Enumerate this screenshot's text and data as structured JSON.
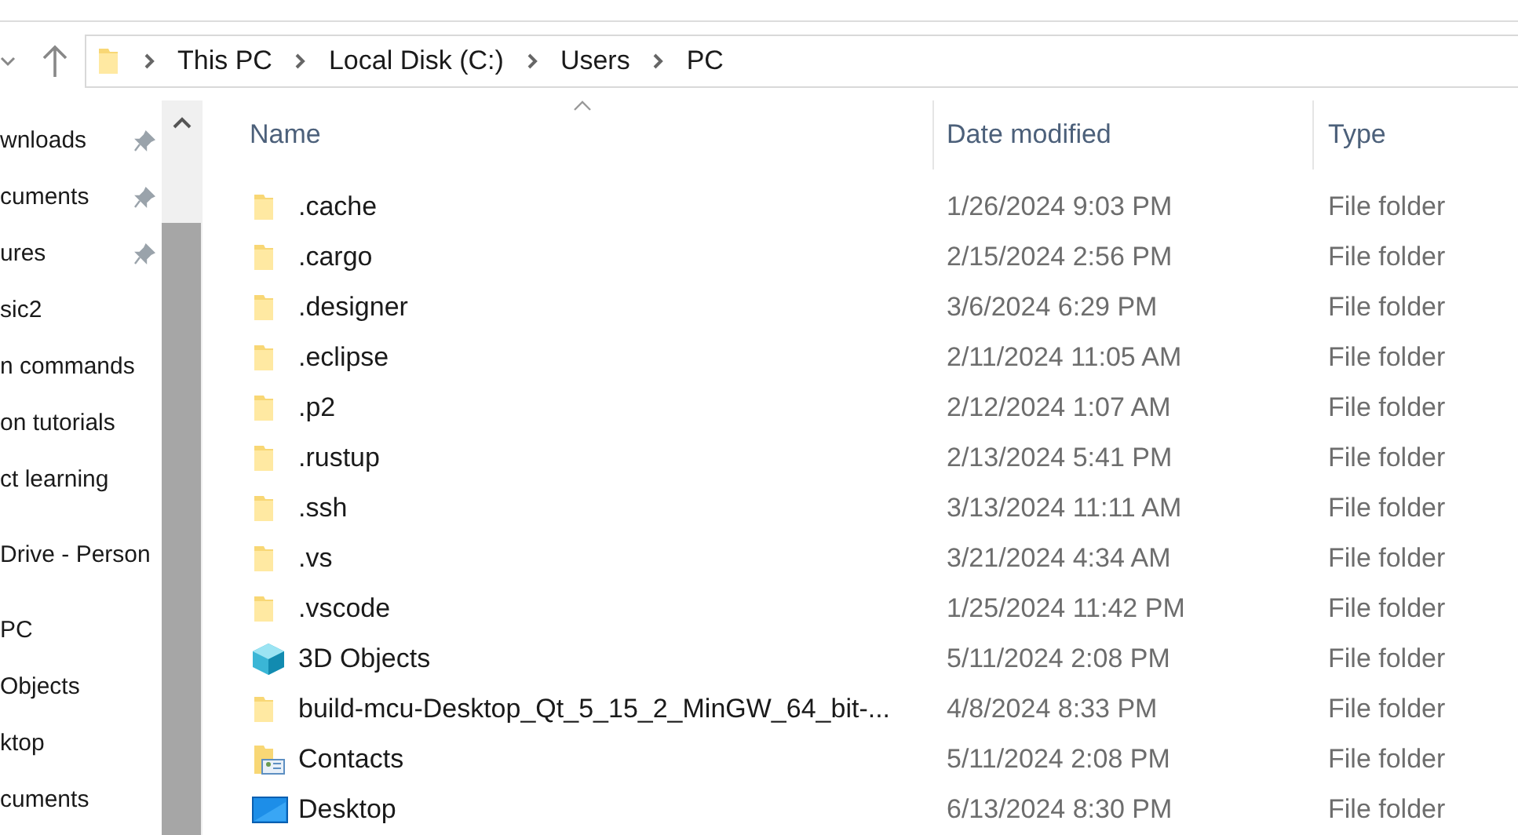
{
  "address_bar": {
    "crumbs": [
      "This PC",
      "Local Disk (C:)",
      "Users",
      "PC"
    ]
  },
  "sidebar": {
    "sections": [
      {
        "items": [
          {
            "label": "wnloads",
            "pinned": true
          },
          {
            "label": "cuments",
            "pinned": true
          },
          {
            "label": "ures",
            "pinned": true
          },
          {
            "label": "sic2",
            "pinned": false
          },
          {
            "label": "n commands",
            "pinned": false
          },
          {
            "label": "on tutorials",
            "pinned": false
          },
          {
            "label": "ct learning",
            "pinned": false
          }
        ]
      },
      {
        "items": [
          {
            "label": "Drive - Person",
            "pinned": false
          }
        ]
      },
      {
        "items": [
          {
            "label": "PC",
            "pinned": false
          },
          {
            "label": "Objects",
            "pinned": false
          },
          {
            "label": "ktop",
            "pinned": false
          },
          {
            "label": "cuments",
            "pinned": false
          }
        ]
      }
    ]
  },
  "table": {
    "columns": [
      {
        "label": "Name",
        "sorted": true
      },
      {
        "label": "Date modified",
        "sorted": false
      },
      {
        "label": "Type",
        "sorted": false
      }
    ],
    "rows": [
      {
        "kind": "folder",
        "name": ".cache",
        "date": "1/26/2024 9:03 PM",
        "type": "File folder"
      },
      {
        "kind": "folder",
        "name": ".cargo",
        "date": "2/15/2024 2:56 PM",
        "type": "File folder"
      },
      {
        "kind": "folder",
        "name": ".designer",
        "date": "3/6/2024 6:29 PM",
        "type": "File folder"
      },
      {
        "kind": "folder",
        "name": ".eclipse",
        "date": "2/11/2024 11:05 AM",
        "type": "File folder"
      },
      {
        "kind": "folder",
        "name": ".p2",
        "date": "2/12/2024 1:07 AM",
        "type": "File folder"
      },
      {
        "kind": "folder",
        "name": ".rustup",
        "date": "2/13/2024 5:41 PM",
        "type": "File folder"
      },
      {
        "kind": "folder",
        "name": ".ssh",
        "date": "3/13/2024 11:11 AM",
        "type": "File folder"
      },
      {
        "kind": "folder",
        "name": ".vs",
        "date": "3/21/2024 4:34 AM",
        "type": "File folder"
      },
      {
        "kind": "folder",
        "name": ".vscode",
        "date": "1/25/2024 11:42 PM",
        "type": "File folder"
      },
      {
        "kind": "cube",
        "name": "3D Objects",
        "date": "5/11/2024 2:08 PM",
        "type": "File folder"
      },
      {
        "kind": "folder",
        "name": "build-mcu-Desktop_Qt_5_15_2_MinGW_64_bit-...",
        "date": "4/8/2024 8:33 PM",
        "type": "File folder"
      },
      {
        "kind": "contacts",
        "name": "Contacts",
        "date": "5/11/2024 2:08 PM",
        "type": "File folder"
      },
      {
        "kind": "desktop",
        "name": "Desktop",
        "date": "6/13/2024 8:30 PM",
        "type": "File folder"
      }
    ]
  }
}
